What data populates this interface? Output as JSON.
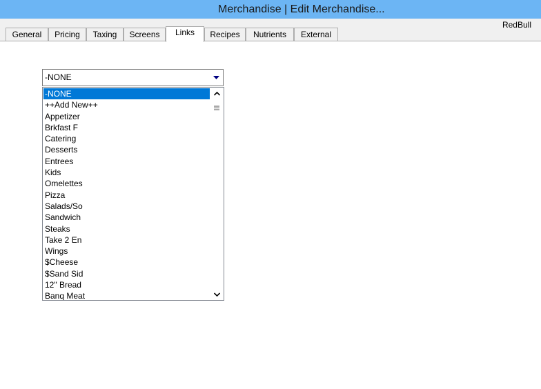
{
  "window": {
    "title": "Merchandise | Edit Merchandise..."
  },
  "item_name": "RedBull",
  "tabs": [
    {
      "label": "General",
      "active": false
    },
    {
      "label": "Pricing",
      "active": false
    },
    {
      "label": "Taxing",
      "active": false
    },
    {
      "label": "Screens",
      "active": false
    },
    {
      "label": "Links",
      "active": true
    },
    {
      "label": "Recipes",
      "active": false
    },
    {
      "label": "Nutrients",
      "active": false
    },
    {
      "label": "External",
      "active": false
    }
  ],
  "combo": {
    "value": "-NONE",
    "icon": "dropdown-arrow-icon"
  },
  "list": {
    "selected": "-NONE",
    "items": [
      "-NONE",
      "++Add New++",
      "Appetizer",
      "Brkfast F",
      "Catering",
      "Desserts",
      "Entrees",
      "Kids",
      "Omelettes",
      "Pizza",
      "Salads/So",
      "Sandwich",
      "Steaks",
      "Take 2 En",
      "Wings",
      "$Cheese",
      "$Sand Sid",
      "12\" Bread",
      "Banq Meat"
    ]
  },
  "colors": {
    "titlebar": "#6cb5f4",
    "selection": "#0078d7"
  }
}
